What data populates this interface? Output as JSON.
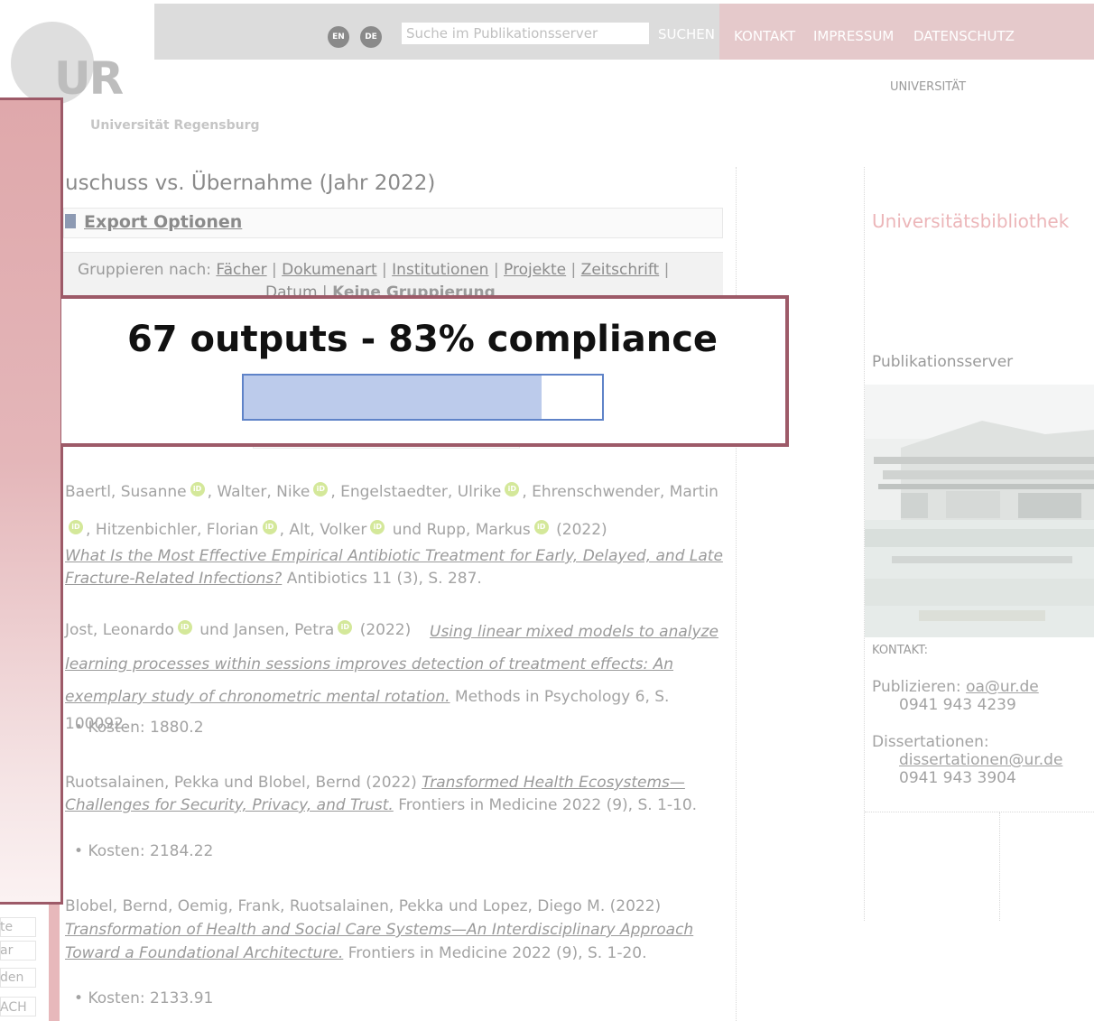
{
  "header": {
    "logo_text": "UR",
    "university_name": "Universität Regensburg",
    "lang_en": "EN",
    "lang_de": "DE",
    "search": {
      "placeholder": "Suche im Publikationsserver",
      "button": "SUCHEN"
    },
    "nav": [
      "KONTAKT",
      "IMPRESSUM",
      "DATENSCHUTZ"
    ],
    "university_link": "UNIVERSITÄT"
  },
  "main": {
    "page_title": "uschuss vs. Übernahme (Jahr 2022)",
    "export_options": "Export Optionen",
    "group_by": {
      "prefix": "Gruppieren nach: ",
      "options": [
        "Fächer",
        "Dokumenart",
        "Institutionen",
        "Projekte",
        "Zeitschrift"
      ],
      "line2_datum": "Datum",
      "line2_active": "Keine Gruppierung"
    },
    "publications": [
      {
        "authors": [
          "Baertl, Susanne",
          "Walter, Nike",
          "Engelstaedter, Ulrike",
          "Ehrenschwender, Martin",
          "Hitzenbichler, Florian",
          "Alt, Volker"
        ],
        "last_author": "Rupp, Markus",
        "year": "(2022)",
        "title": "What Is the Most Effective Empirical Antibiotic Treatment for Early, Delayed, and Late Fracture-Related Infections?",
        "source": "Antibiotics 11 (3), S. 287."
      },
      {
        "authors": [
          "Jost, Leonardo"
        ],
        "last_author": "Jansen, Petra",
        "year": "(2022)",
        "title": "Using linear mixed models to analyze learning processes within sessions improves detection of treatment effects: An exemplary study of chronometric mental rotation.",
        "source": "Methods in Psychology 6, S. 100092.",
        "cost": "Kosten: 1880.2"
      },
      {
        "authors_text": "Ruotsalainen, Pekka und Blobel, Bernd (2022)",
        "title": "Transformed Health Ecosystems—Challenges for Security, Privacy, and Trust.",
        "source": "Frontiers in Medicine 2022 (9), S. 1-10.",
        "cost": "Kosten: 2184.22"
      },
      {
        "authors_text": "Blobel, Bernd, Oemig, Frank, Ruotsalainen, Pekka und Lopez, Diego M. (2022)",
        "title": "Transformation of Health and Social Care Systems—An Interdisciplinary Approach Toward a Foundational Architecture.",
        "source": "Frontiers in Medicine 2022 (9), S. 1-20.",
        "cost": "Kosten: 2133.91"
      }
    ],
    "und": "und"
  },
  "sidebar": {
    "library": "Universitätsbibliothek",
    "server": "Publikationsserver",
    "contact_label": "KONTAKT:",
    "publish_label": "Publizieren:",
    "publish_email": "oa@ur.de",
    "publish_phone": "0941 943 4239",
    "diss_label": "Dissertationen:",
    "diss_email": "dissertationen@ur.de",
    "diss_phone": "0941 943 3904"
  },
  "left_menu_fragments": [
    "te",
    "ar",
    "den",
    "ACH"
  ],
  "overlay": {
    "summary": "67 outputs - 83% compliance",
    "compliance_fraction": 0.83
  }
}
